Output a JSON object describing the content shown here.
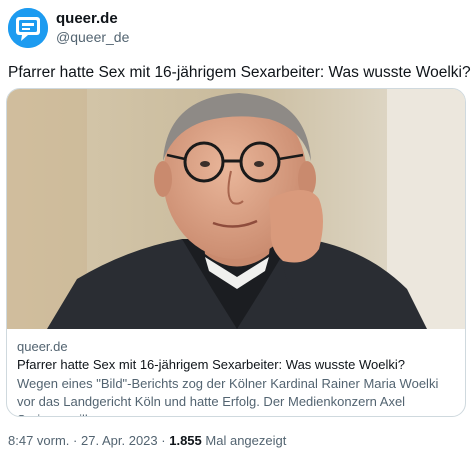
{
  "author": {
    "name": "queer.de",
    "handle": "@queer_de",
    "avatar_icon": "chat-bubble-logo-icon"
  },
  "tweet": {
    "text": "Pfarrer hatte Sex mit 16-jährigem Sexarbeiter: Was wusste Woelki?"
  },
  "card": {
    "image_icon": "portrait-photo",
    "domain": "queer.de",
    "title": "Pfarrer hatte Sex mit 16-jährigem Sexarbeiter: Was wusste Woelki?",
    "description": "Wegen eines \"Bild\"-Berichts zog der Kölner Kardinal Rainer Maria Woelki vor das Landgericht Köln und hatte Erfolg. Der Medienkonzern Axel Springer will ..."
  },
  "meta": {
    "time": "8:47 vorm.",
    "separator": "·",
    "date": "27. Apr. 2023",
    "views": "1.855",
    "views_label": "Mal angezeigt"
  },
  "colors": {
    "brand": "#1d9bf0",
    "text_primary": "#0f1419",
    "text_secondary": "#536471",
    "border": "#cfd9de"
  }
}
